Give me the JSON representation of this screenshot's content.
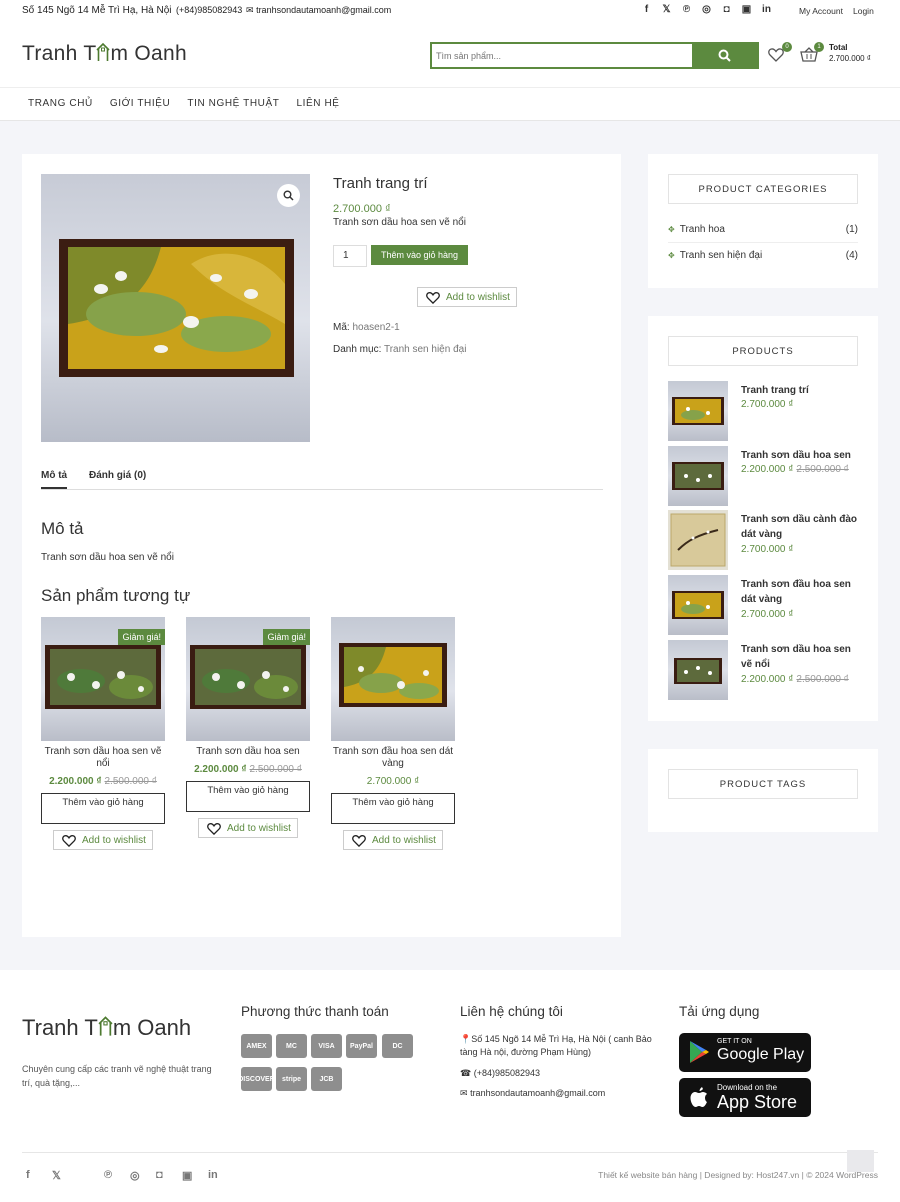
{
  "topbar": {
    "address": "Số 145 Ngõ 14 Mễ Trì Hạ, Hà Nội",
    "phone": "(+84)985082943",
    "email": "tranhsondautamoanh@gmail.com",
    "socials": [
      "facebook-icon",
      "x-icon",
      "pinterest-icon",
      "dribbble-icon",
      "instagram-icon",
      "flickr-icon",
      "linkedin-icon"
    ],
    "my_account": "My Account",
    "login": "Login"
  },
  "header": {
    "logo_text_a": "Tranh T",
    "logo_text_b": "m Oanh",
    "search_placeholder": "Tìm sản phẩm...",
    "wishlist_count": "0",
    "cart_count": "1",
    "total_label": "Total",
    "total_value": "2.700.000 ₫"
  },
  "nav": {
    "items": [
      "TRANG CHỦ",
      "GIỚI THIỆU",
      "TIN NGHỆ THUẬT",
      "LIÊN HỆ"
    ]
  },
  "product": {
    "title": "Tranh trang trí",
    "price": "2.700.000 ₫",
    "short_desc": "Tranh sơn dầu hoa sen vẽ nổi",
    "qty": "1",
    "add_to_cart": "Thêm vào giỏ hàng",
    "add_to_wishlist": "Add to wishlist",
    "sku_label": "Mã:",
    "sku": "hoasen2-1",
    "cat_label": "Danh mục:",
    "category": "Tranh sen hiện đại",
    "tabs": [
      "Mô tả",
      "Đánh giá (0)"
    ],
    "desc_heading": "Mô tả",
    "desc_text": "Tranh sơn dầu hoa sen vẽ nổi",
    "related_heading": "Sản phẩm tương tự"
  },
  "related": [
    {
      "sale": "Giảm giá!",
      "name": "Tranh sơn dầu hoa sen vẽ nổi",
      "price": "2.200.000 ₫",
      "old_price": "2.500.000 ₫",
      "button": "Thêm vào giỏ hàng",
      "wishlist": "Add to wishlist"
    },
    {
      "sale": "Giảm giá!",
      "name": "Tranh sơn dầu hoa sen",
      "price": "2.200.000 ₫",
      "old_price": "2.500.000 ₫",
      "button": "Thêm vào giỏ hàng",
      "wishlist": "Add to wishlist"
    },
    {
      "sale": "",
      "name": "Tranh sơn đầu hoa sen dát vàng",
      "price": "2.700.000 ₫",
      "old_price": "",
      "button": "Thêm vào giỏ hàng",
      "wishlist": "Add to wishlist"
    }
  ],
  "sidebar": {
    "categories_title": "PRODUCT CATEGORIES",
    "categories": [
      {
        "name": "Tranh hoa",
        "count": "(1)"
      },
      {
        "name": "Tranh sen hiện đại",
        "count": "(4)"
      }
    ],
    "products_title": "PRODUCTS",
    "products": [
      {
        "name": "Tranh trang trí",
        "price": "2.700.000 ₫",
        "old_price": ""
      },
      {
        "name": "Tranh sơn dầu hoa sen",
        "price": "2.200.000 ₫",
        "old_price": "2.500.000 ₫"
      },
      {
        "name": "Tranh sơn dầu cành đào dát vàng",
        "price": "2.700.000 ₫",
        "old_price": ""
      },
      {
        "name": "Tranh sơn đầu hoa sen dát vàng",
        "price": "2.700.000 ₫",
        "old_price": ""
      },
      {
        "name": "Tranh sơn dầu hoa sen vẽ nổi",
        "price": "2.200.000 ₫",
        "old_price": "2.500.000 ₫"
      }
    ],
    "tags_title": "PRODUCT TAGS"
  },
  "footer": {
    "about": "Chuyên cung cấp các tranh vẽ nghệ thuật trang trí, quà tặng,...",
    "payment_heading": "Phương thức thanh toán",
    "payments": [
      "AMEX",
      "MC",
      "VISA",
      "PayPal",
      "DC",
      "DISCOVER",
      "stripe",
      "JCB"
    ],
    "contact_heading": "Liên hệ chúng tôi",
    "contact_address": "Số 145 Ngõ 14 Mễ Trì Hạ, Hà Nội ( canh Bảo tàng Hà nội, đường Phạm Hùng)",
    "contact_phone": "(+84)985082943",
    "contact_email": "tranhsondautamoanh@gmail.com",
    "app_heading": "Tải ứng dụng",
    "google_small": "GET IT ON",
    "google_big": "Google Play",
    "apple_small": "Download on the",
    "apple_big": "App Store",
    "copyright": "Thiết kế website bán hàng | Designed by: Host247.vn | © 2024 WordPress"
  },
  "colors": {
    "brand_green": "#5c8a3f",
    "page_bg": "#f4f5f9"
  }
}
